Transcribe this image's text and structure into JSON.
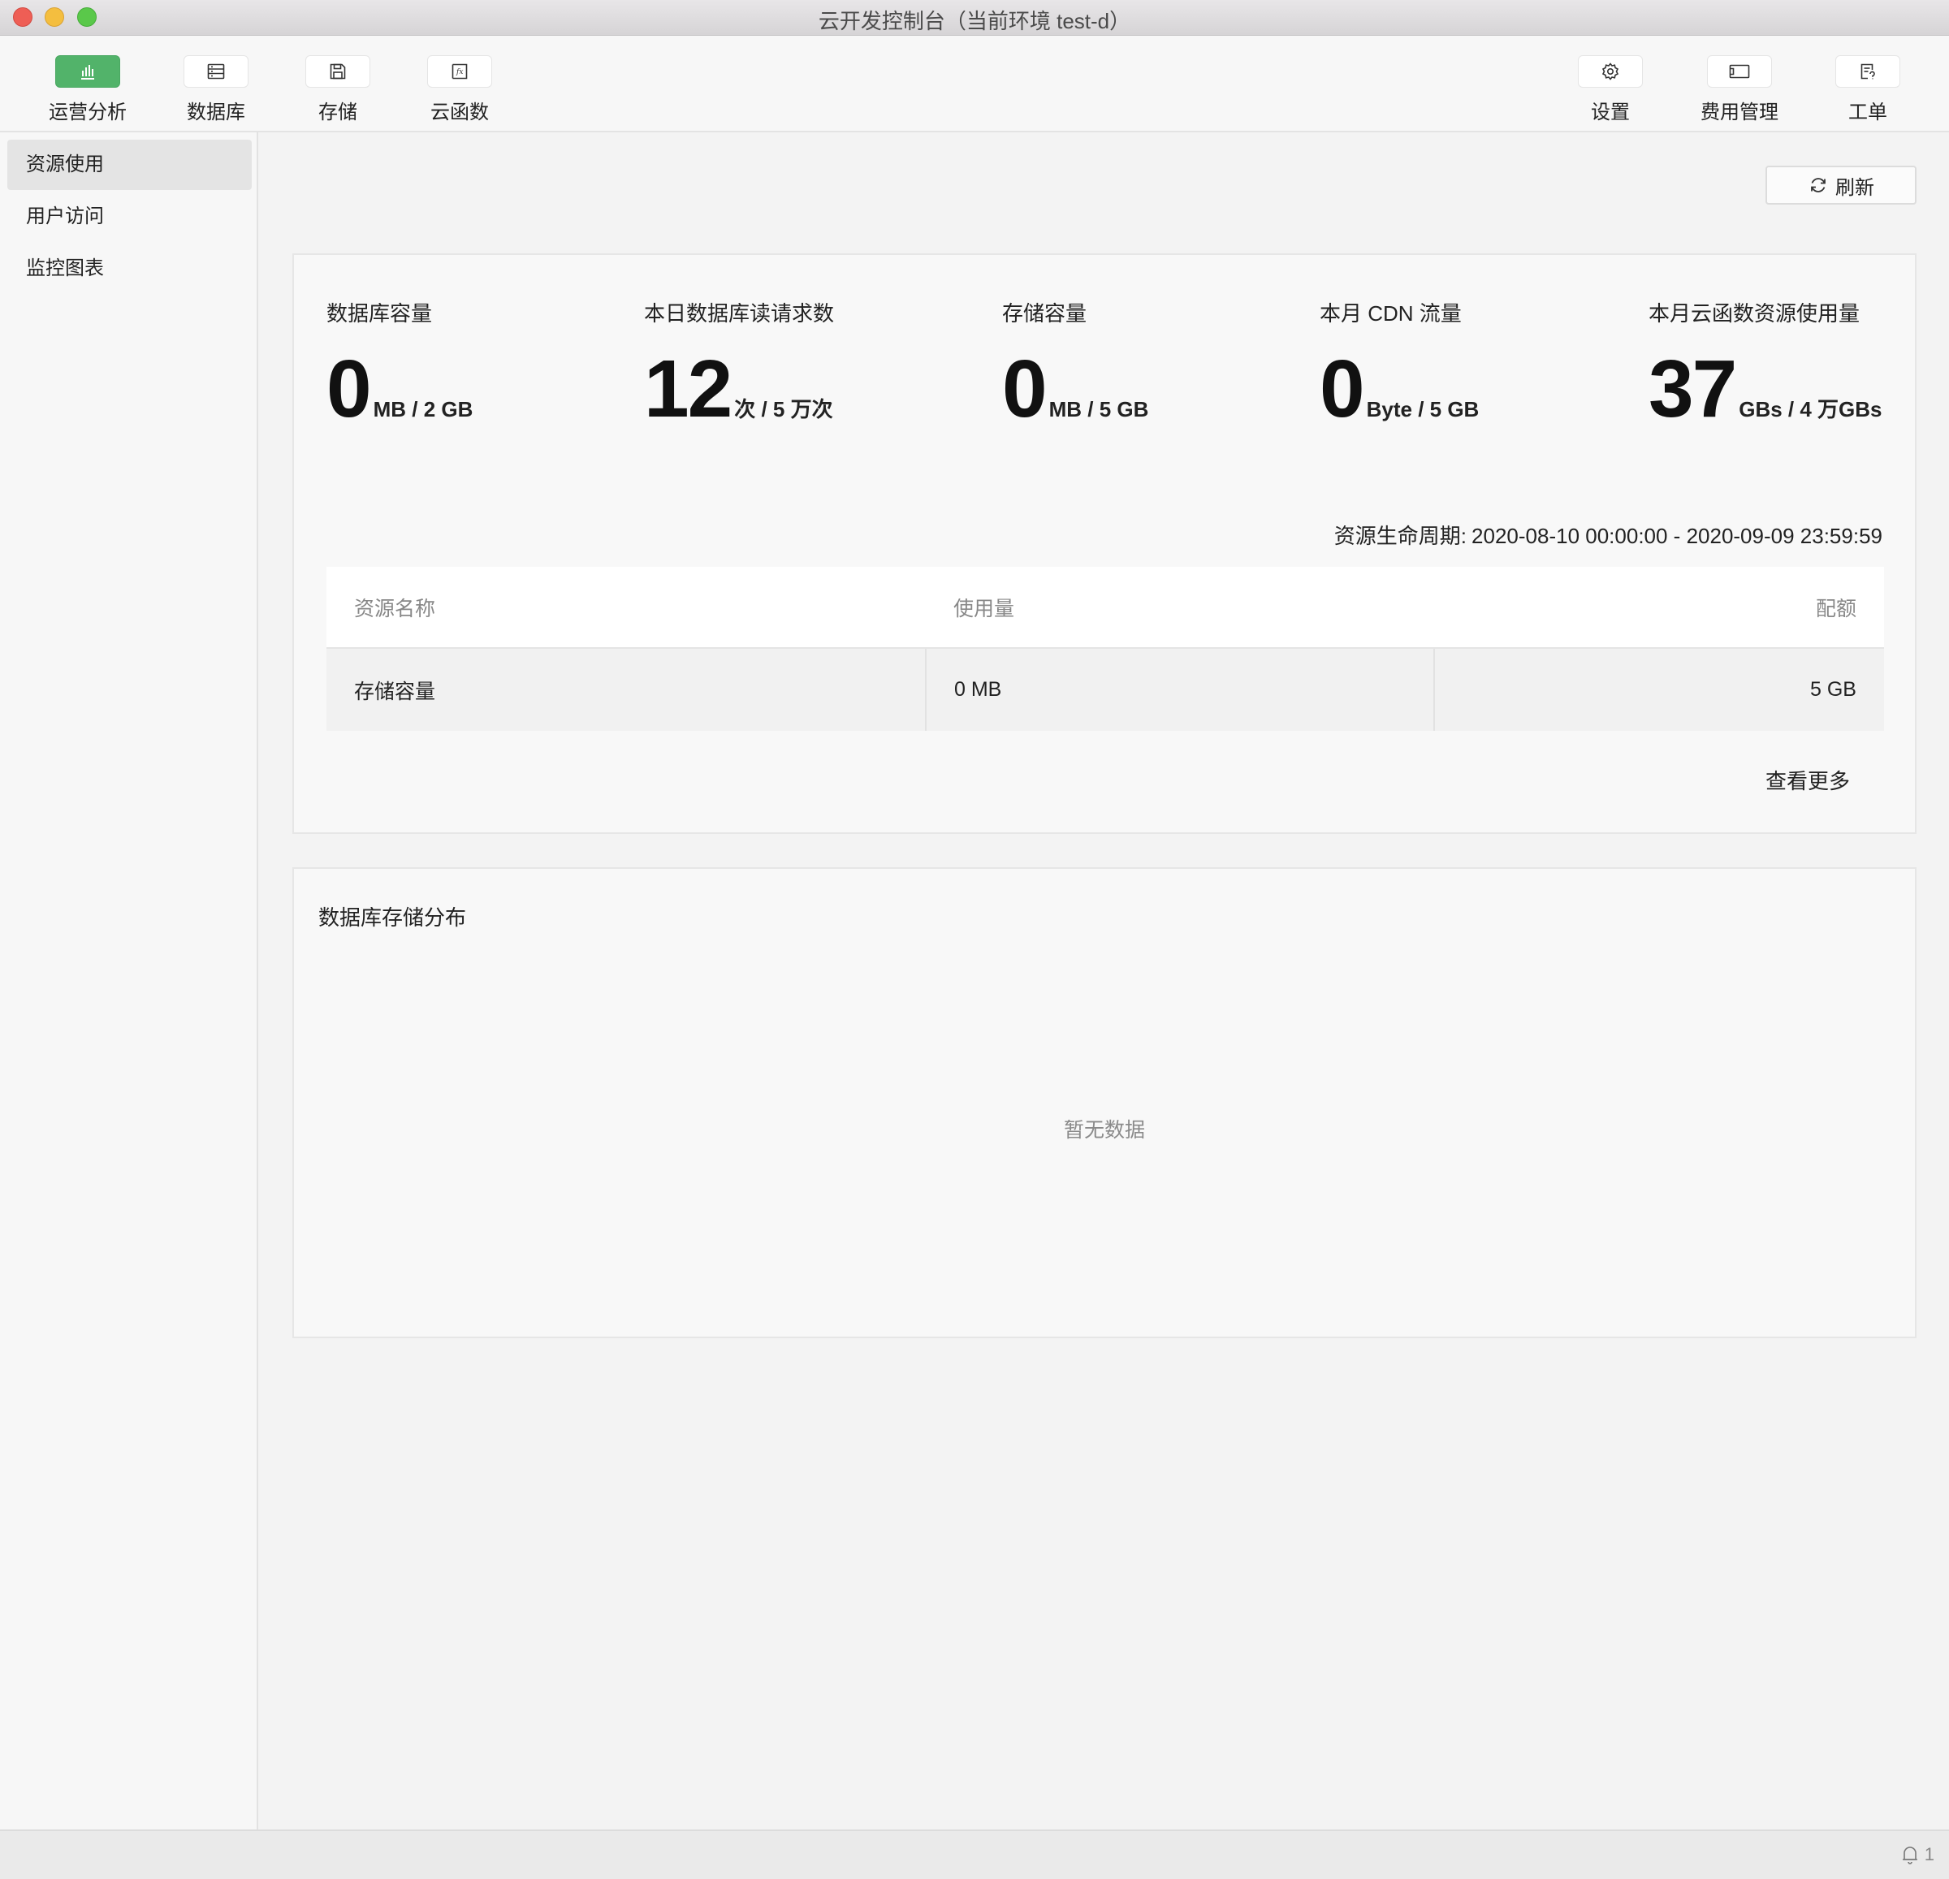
{
  "window": {
    "title": "云开发控制台（当前环境 test-d）"
  },
  "toolbar": {
    "left": [
      {
        "label": "运营分析",
        "icon": "bar-chart-icon",
        "active": true
      },
      {
        "label": "数据库",
        "icon": "database-icon"
      },
      {
        "label": "存储",
        "icon": "floppy-disk-icon"
      },
      {
        "label": "云函数",
        "icon": "function-icon"
      }
    ],
    "right": [
      {
        "label": "设置",
        "icon": "gear-icon"
      },
      {
        "label": "费用管理",
        "icon": "wallet-icon"
      },
      {
        "label": "工单",
        "icon": "ticket-icon"
      }
    ]
  },
  "sidebar": {
    "items": [
      {
        "label": "资源使用",
        "active": true
      },
      {
        "label": "用户访问"
      },
      {
        "label": "监控图表"
      }
    ]
  },
  "content": {
    "refresh_label": "刷新",
    "metrics": [
      {
        "label": "数据库容量",
        "value": "0",
        "unit": "MB / 2 GB"
      },
      {
        "label": "本日数据库读请求数",
        "value": "12",
        "unit": "次 / 5 万次"
      },
      {
        "label": "存储容量",
        "value": "0",
        "unit": "MB / 5 GB"
      },
      {
        "label": "本月 CDN 流量",
        "value": "0",
        "unit": "Byte / 5 GB"
      },
      {
        "label": "本月云函数资源使用量",
        "value": "37",
        "unit": "GBs / 4 万GBs"
      }
    ],
    "period_label": "资源生命周期:",
    "period_value": "2020-08-10 00:00:00 - 2020-09-09 23:59:59",
    "table": {
      "headers": [
        "资源名称",
        "使用量",
        "配额"
      ],
      "rows": [
        [
          "存储容量",
          "0 MB",
          "5 GB"
        ]
      ]
    },
    "more_label": "查看更多",
    "db_dist_title": "数据库存储分布",
    "empty_text": "暂无数据"
  },
  "statusbar": {
    "notification_count": "1"
  },
  "colors": {
    "accent": "#52b36a"
  }
}
